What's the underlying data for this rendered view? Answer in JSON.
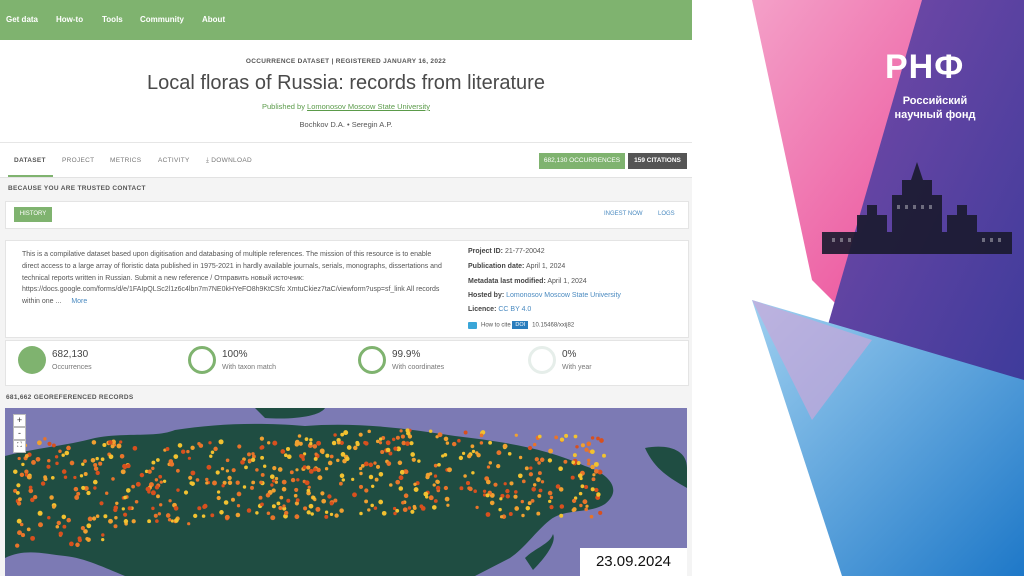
{
  "nav": {
    "items": [
      "Get data",
      "How-to",
      "Tools",
      "Community",
      "About"
    ]
  },
  "dataset": {
    "type_line": "OCCURRENCE DATASET  |  REGISTERED JANUARY 16, 2022",
    "title": "Local floras of Russia: records from literature",
    "published_by_prefix": "Published by ",
    "publisher": "Lomonosov Moscow State University",
    "authors": "Bochkov D.A. • Seregin A.P."
  },
  "tabs": [
    {
      "label": "DATASET"
    },
    {
      "label": "PROJECT"
    },
    {
      "label": "METRICS"
    },
    {
      "label": "ACTIVITY"
    },
    {
      "label": "⤓ DOWNLOAD"
    }
  ],
  "buttons": {
    "occurrences": "682,130 OCCURRENCES",
    "citations": "159 CITATIONS",
    "history": "HISTORY",
    "ingest_now": "INGEST NOW",
    "logs": "LOGS"
  },
  "trusted_notice": "BECAUSE YOU ARE TRUSTED CONTACT",
  "description": {
    "text": "This is a compilative dataset based upon digitisation and databasing of multiple references. The mission of this resource is to enable direct access to a large array of floristic data published in 1975-2021 in hardly available journals, serials, monographs, dissertations and technical reports written in Russian. Submit a new reference / Отправить новый источник: https://docs.google.com/forms/d/e/1FAIpQLSc2l1z6c4lbn7m7NE0kHYeFO8h9KtCSfc XmtuCkiez7taC/viewform?usp=sf_link All records within one ...",
    "more": "More"
  },
  "meta": {
    "project_label": "Project ID:",
    "project_value": "21-77-20042",
    "pubdate_label": "Publication date:",
    "pubdate_value": "April 1, 2024",
    "modified_label": "Metadata last modified:",
    "modified_value": "April 1, 2024",
    "hosted_label": "Hosted by:",
    "hosted_value": "Lomonosov Moscow State University",
    "licence_label": "Licence:",
    "licence_value": "CC BY 4.0",
    "howto_cite": "How to cite",
    "doi_badge": "DOI",
    "doi_value": "10.15468/xxij82"
  },
  "stats": [
    {
      "value": "682,130",
      "label": "Occurrences",
      "fraction": 1.0
    },
    {
      "value": "100%",
      "label": "With taxon match",
      "fraction": 1.0
    },
    {
      "value": "99.9%",
      "label": "With coordinates",
      "fraction": 0.999
    },
    {
      "value": "0%",
      "label": "With year",
      "fraction": 0.0
    }
  ],
  "map": {
    "header": "681,662 GEOREFERENCED RECORDS",
    "zoom_in": "+",
    "zoom_out": "-",
    "fullscreen": "⛶"
  },
  "date_stamp": "23.09.2024",
  "logo": {
    "name": "РНФ",
    "line1": "Российский",
    "line2": "научный фонд"
  },
  "colors": {
    "gbif_green": "#7fb36f",
    "ocean": "#7c7ab4",
    "land": "#1f4d42",
    "hex_orange": "#e8742a",
    "hex_yellow": "#f2c230",
    "rnf_magenta": "#e8338a",
    "rnf_blue": "#2d7fd0",
    "rnf_purple": "#5a4aa8"
  }
}
